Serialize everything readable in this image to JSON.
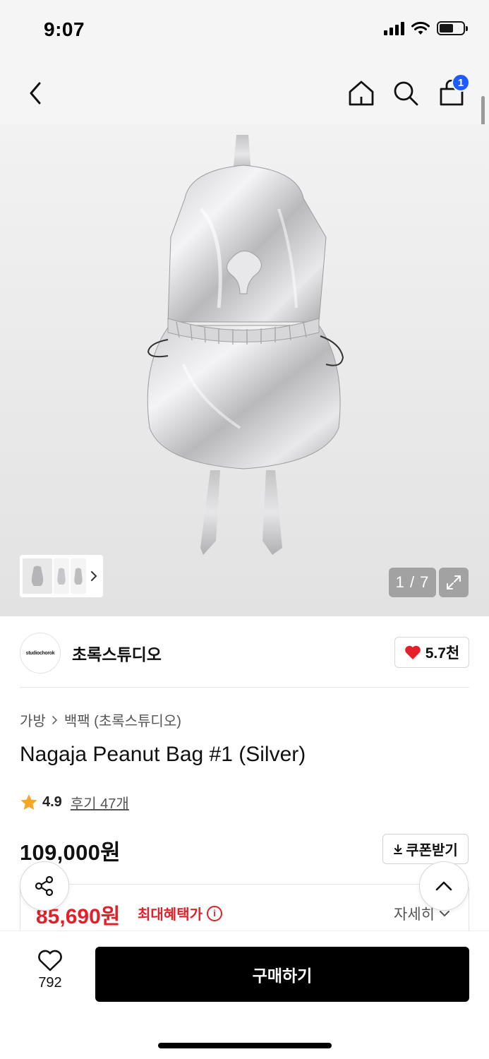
{
  "status_bar": {
    "time": "9:07"
  },
  "nav": {
    "cart_count": "1"
  },
  "gallery": {
    "page_counter": "1 / 7",
    "image_count": 7,
    "current_index": 1
  },
  "brand": {
    "name": "초록스튜디오",
    "logo_text": "studiochorok",
    "like_count": "5.7천"
  },
  "breadcrumb": [
    "가방",
    "백팩 (초록스튜디오)"
  ],
  "product": {
    "title": "Nagaja Peanut Bag #1 (Silver)",
    "rating": "4.9",
    "reviews": "후기 47개",
    "price": "109,000원"
  },
  "coupon": {
    "label": "쿠폰받기"
  },
  "benefit": {
    "price": "85,690원",
    "label": "최대혜택가",
    "detail": "자세히"
  },
  "bottom": {
    "wish_count": "792",
    "buy_label": "구매하기"
  },
  "colors": {
    "accent_blue": "#1a5cff",
    "benefit_red": "#e3202a",
    "heart_red": "#e5202a",
    "star": "#f5a623",
    "buy_button": "#000000"
  }
}
